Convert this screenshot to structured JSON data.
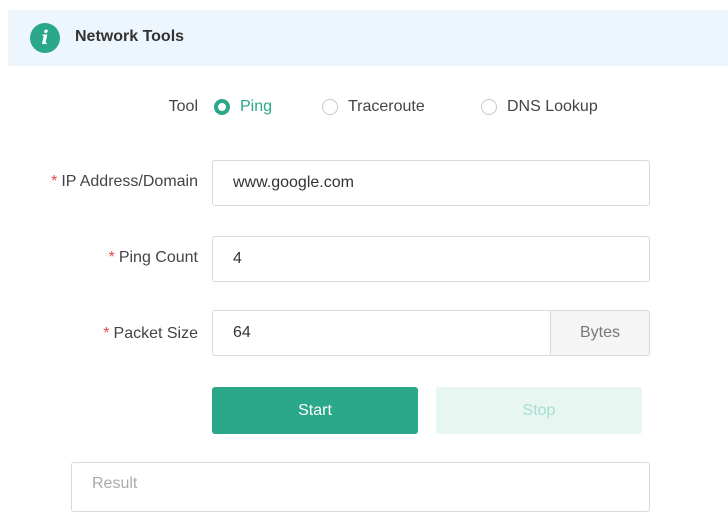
{
  "header": {
    "icon": "info-icon",
    "icon_glyph": "i",
    "title": "Network Tools"
  },
  "tool": {
    "label": "Tool",
    "options": [
      {
        "label": "Ping",
        "selected": true
      },
      {
        "label": "Traceroute",
        "selected": false
      },
      {
        "label": "DNS Lookup",
        "selected": false
      }
    ]
  },
  "form": {
    "required_mark": "*",
    "ip": {
      "label": "IP Address/Domain",
      "value": "www.google.com"
    },
    "count": {
      "label": "Ping Count",
      "value": "4"
    },
    "size": {
      "label": "Packet Size",
      "value": "64",
      "unit": "Bytes"
    }
  },
  "buttons": {
    "start": "Start",
    "stop": "Stop"
  },
  "result": {
    "placeholder": "Result"
  },
  "colors": {
    "accent": "#2aa889",
    "header_bg": "#eef6fd",
    "required": "#e5484d"
  }
}
